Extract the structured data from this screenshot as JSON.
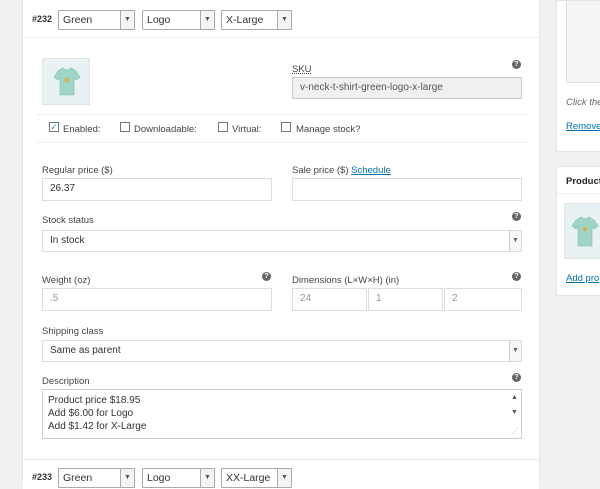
{
  "variation_top": {
    "number": "#232",
    "color": "Green",
    "design": "Logo",
    "size": "X-Large"
  },
  "variation_bottom": {
    "number": "#233",
    "color": "Green",
    "design": "Logo",
    "size": "XX-Large"
  },
  "sku": {
    "label": "SKU",
    "value": "v-neck-t-shirt-green-logo-x-large"
  },
  "options": {
    "enabled_label": "Enabled:",
    "downloadable_label": "Downloadable:",
    "virtual_label": "Virtual:",
    "manage_stock_label": "Manage stock?"
  },
  "pricing": {
    "regular_label": "Regular price ($)",
    "regular_value": "26.37",
    "sale_label": "Sale price ($)",
    "schedule_link": "Schedule",
    "sale_value": ""
  },
  "stock": {
    "label": "Stock status",
    "value": "In stock"
  },
  "weight": {
    "label": "Weight (oz)",
    "placeholder": ".5"
  },
  "dimensions": {
    "label": "Dimensions (L×W×H) (in)",
    "length": "24",
    "width": "1",
    "height": "2"
  },
  "shipping": {
    "label": "Shipping class",
    "value": "Same as parent"
  },
  "description": {
    "label": "Description",
    "lines": [
      "Product price $18.95",
      "Add $6.00 for Logo",
      "Add $1.42 for X-Large"
    ]
  },
  "sidebar": {
    "click_text": "Click the",
    "remove_link": "Remove",
    "product_panel_title": "Product",
    "add_link": "Add pro"
  },
  "icons": {
    "help": "question-mark-circle-icon",
    "dropdown": "chevron-down-icon",
    "checkbox_checked": "check-icon"
  }
}
